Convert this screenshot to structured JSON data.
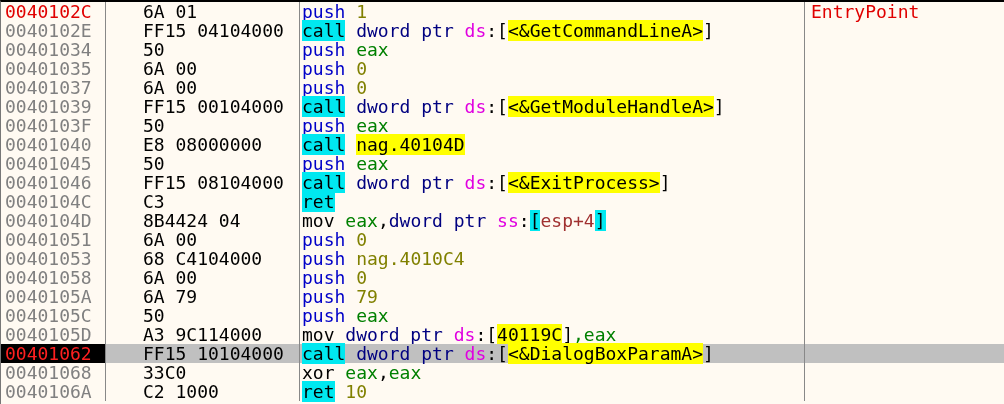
{
  "rows": [
    {
      "kind": "entry",
      "address": "0040102C",
      "bytes": "6A 01",
      "tokens": [
        {
          "kind": "push",
          "text": "push"
        },
        {
          "kind": "num",
          "text": " 1"
        }
      ],
      "comment": "EntryPoint"
    },
    {
      "kind": "plain",
      "address": "0040102E",
      "bytes": "FF15 04104000",
      "tokens": [
        {
          "kind": "call",
          "text": "call"
        },
        {
          "kind": "size",
          "text": " dword ptr "
        },
        {
          "kind": "seg",
          "text": "ds"
        },
        {
          "kind": "punct",
          "text": ":["
        },
        {
          "kind": "label",
          "text": "<&GetCommandLineA>"
        },
        {
          "kind": "punct",
          "text": "]"
        }
      ]
    },
    {
      "kind": "plain",
      "address": "00401034",
      "bytes": "50",
      "tokens": [
        {
          "kind": "push",
          "text": "push"
        },
        {
          "kind": "reg",
          "text": " eax"
        }
      ]
    },
    {
      "kind": "plain",
      "address": "00401035",
      "bytes": "6A 00",
      "tokens": [
        {
          "kind": "push",
          "text": "push"
        },
        {
          "kind": "num",
          "text": " 0"
        }
      ]
    },
    {
      "kind": "plain",
      "address": "00401037",
      "bytes": "6A 00",
      "tokens": [
        {
          "kind": "push",
          "text": "push"
        },
        {
          "kind": "num",
          "text": " 0"
        }
      ]
    },
    {
      "kind": "plain",
      "address": "00401039",
      "bytes": "FF15 00104000",
      "tokens": [
        {
          "kind": "call",
          "text": "call"
        },
        {
          "kind": "size",
          "text": " dword ptr "
        },
        {
          "kind": "seg",
          "text": "ds"
        },
        {
          "kind": "punct",
          "text": ":["
        },
        {
          "kind": "label",
          "text": "<&GetModuleHandleA>"
        },
        {
          "kind": "punct",
          "text": "]"
        }
      ]
    },
    {
      "kind": "plain",
      "address": "0040103F",
      "bytes": "50",
      "tokens": [
        {
          "kind": "push",
          "text": "push"
        },
        {
          "kind": "reg",
          "text": " eax"
        }
      ]
    },
    {
      "kind": "plain",
      "address": "00401040",
      "bytes": "E8 08000000",
      "tokens": [
        {
          "kind": "call",
          "text": "call"
        },
        {
          "kind": "label",
          "text": "nag.40104D",
          "gap": true
        }
      ]
    },
    {
      "kind": "plain",
      "address": "00401045",
      "bytes": "50",
      "tokens": [
        {
          "kind": "push",
          "text": "push"
        },
        {
          "kind": "reg",
          "text": " eax"
        }
      ]
    },
    {
      "kind": "plain",
      "address": "00401046",
      "bytes": "FF15 08104000",
      "tokens": [
        {
          "kind": "call",
          "text": "call"
        },
        {
          "kind": "size",
          "text": " dword ptr "
        },
        {
          "kind": "seg",
          "text": "ds"
        },
        {
          "kind": "punct",
          "text": ":["
        },
        {
          "kind": "label",
          "text": "<&ExitProcess>"
        },
        {
          "kind": "punct",
          "text": "]"
        }
      ]
    },
    {
      "kind": "plain",
      "address": "0040104C",
      "bytes": "C3",
      "tokens": [
        {
          "kind": "ret",
          "text": "ret"
        }
      ]
    },
    {
      "kind": "plain",
      "address": "0040104D",
      "bytes": "8B4424 04",
      "tokens": [
        {
          "kind": "op",
          "text": "mov"
        },
        {
          "kind": "reg",
          "text": " eax"
        },
        {
          "kind": "punct",
          "text": ","
        },
        {
          "kind": "size",
          "text": "dword ptr "
        },
        {
          "kind": "seg",
          "text": "ss"
        },
        {
          "kind": "punct",
          "text": ":"
        },
        {
          "kind": "bracket",
          "text": "["
        },
        {
          "kind": "memreg",
          "text": "esp+4"
        },
        {
          "kind": "bracket",
          "text": "]"
        }
      ]
    },
    {
      "kind": "plain",
      "address": "00401051",
      "bytes": "6A 00",
      "tokens": [
        {
          "kind": "push",
          "text": "push"
        },
        {
          "kind": "num",
          "text": " 0"
        }
      ]
    },
    {
      "kind": "plain",
      "address": "00401053",
      "bytes": "68 C4104000",
      "tokens": [
        {
          "kind": "push",
          "text": "push"
        },
        {
          "kind": "num",
          "text": " nag.4010C4"
        }
      ]
    },
    {
      "kind": "plain",
      "address": "00401058",
      "bytes": "6A 00",
      "tokens": [
        {
          "kind": "push",
          "text": "push"
        },
        {
          "kind": "num",
          "text": " 0"
        }
      ]
    },
    {
      "kind": "plain",
      "address": "0040105A",
      "bytes": "6A 79",
      "tokens": [
        {
          "kind": "push",
          "text": "push"
        },
        {
          "kind": "num",
          "text": " 79"
        }
      ]
    },
    {
      "kind": "plain",
      "address": "0040105C",
      "bytes": "50",
      "tokens": [
        {
          "kind": "push",
          "text": "push"
        },
        {
          "kind": "reg",
          "text": " eax"
        }
      ]
    },
    {
      "kind": "plain",
      "address": "0040105D",
      "bytes": "A3 9C114000",
      "tokens": [
        {
          "kind": "op",
          "text": "mov"
        },
        {
          "kind": "size",
          "text": " dword ptr "
        },
        {
          "kind": "seg",
          "text": "ds"
        },
        {
          "kind": "punct",
          "text": ":["
        },
        {
          "kind": "label",
          "text": "40119C"
        },
        {
          "kind": "punct",
          "text": "]"
        },
        {
          "kind": "reg",
          "text": ",eax"
        }
      ]
    },
    {
      "kind": "eip",
      "address": "00401062",
      "bytes": "FF15 10104000",
      "tokens": [
        {
          "kind": "call",
          "text": "call"
        },
        {
          "kind": "size",
          "text": " dword ptr "
        },
        {
          "kind": "seg",
          "text": "ds"
        },
        {
          "kind": "punct",
          "text": ":["
        },
        {
          "kind": "label",
          "text": "<&DialogBoxParamA>"
        },
        {
          "kind": "punct",
          "text": "]"
        }
      ]
    },
    {
      "kind": "plain",
      "address": "00401068",
      "bytes": "33C0",
      "tokens": [
        {
          "kind": "op",
          "text": "xor"
        },
        {
          "kind": "reg",
          "text": " eax"
        },
        {
          "kind": "punct",
          "text": ","
        },
        {
          "kind": "reg",
          "text": "eax"
        }
      ]
    },
    {
      "kind": "plain",
      "address": "0040106A",
      "bytes": "C2 1000",
      "tokens": [
        {
          "kind": "ret",
          "text": "ret"
        },
        {
          "kind": "num",
          "text": " 10"
        }
      ]
    }
  ]
}
